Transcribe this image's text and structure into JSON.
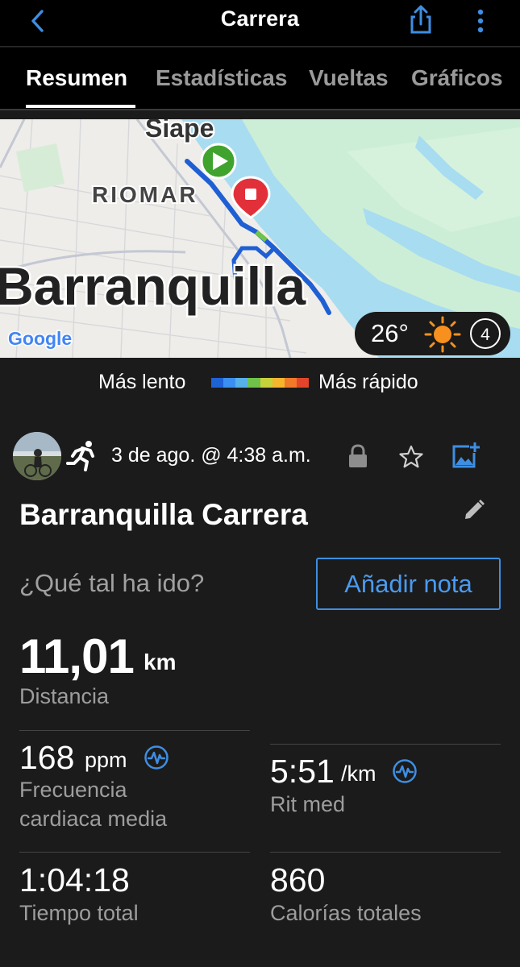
{
  "header": {
    "title": "Carrera",
    "icons": {
      "back": "chevron-left-icon",
      "share": "share-icon",
      "more": "more-vertical-icon"
    },
    "accent": "#3e8ee2"
  },
  "tabs": [
    {
      "label": "Resumen",
      "active": true
    },
    {
      "label": "Estadísticas",
      "active": false
    },
    {
      "label": "Vueltas",
      "active": false
    },
    {
      "label": "Gráficos",
      "active": false
    }
  ],
  "map": {
    "labels": {
      "area": "Siape",
      "neighborhood": "RIOMAR",
      "city": "Barranquilla",
      "attribution": "Google"
    },
    "weather": {
      "temperature": "26°",
      "wind": "4",
      "condition_icon": "sun-icon"
    }
  },
  "pace_legend": {
    "slow": "Más lento",
    "fast": "Más rápido",
    "colors": [
      "#1e63d6",
      "#3a8ff0",
      "#57b0e8",
      "#6fc24a",
      "#c6d23c",
      "#f5b52c",
      "#f07a2a",
      "#e2452a"
    ]
  },
  "activity": {
    "date_time": "3 de ago. @ 4:38 a.m.",
    "name": "Barranquilla Carrera",
    "question": "¿Qué tal ha ido?",
    "add_note": "Añadir nota",
    "icons": {
      "type": "running-icon",
      "privacy": "lock-icon",
      "favorite": "star-icon",
      "add_photo": "add-photo-icon",
      "edit": "pencil-icon"
    }
  },
  "stats": {
    "distance": {
      "value": "11,01",
      "unit": "km",
      "label": "Distancia"
    },
    "avg_hr": {
      "value": "168",
      "unit": "ppm",
      "label_line1": "Frecuencia",
      "label_line2": "cardiaca media"
    },
    "avg_pace": {
      "value": "5:51",
      "unit": "/km",
      "label": "Rit med"
    },
    "total_time": {
      "value": "1:04:18",
      "label": "Tiempo total"
    },
    "calories": {
      "value": "860",
      "label": "Calorías totales"
    }
  }
}
